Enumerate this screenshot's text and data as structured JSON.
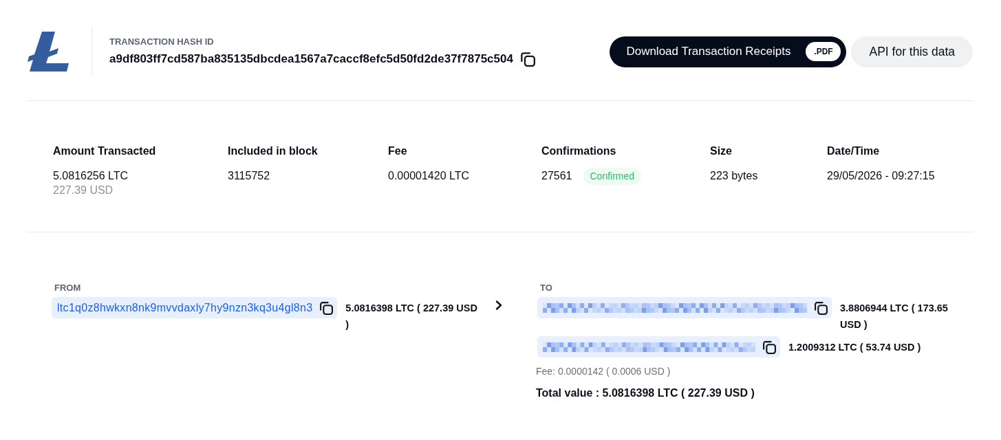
{
  "header": {
    "hash_label": "TRANSACTION HASH ID",
    "hash": "a9df803ff7cd587ba835135dbcdea1567a7caccf8efc5d50fd2de37f7875c504",
    "buttons": [
      {
        "kind": "download",
        "label": "Download Transaction Receipts",
        "tag": ".PDF"
      },
      {
        "kind": "api",
        "label": "API for this data"
      }
    ]
  },
  "stats": [
    {
      "label": "Amount Transacted",
      "value": "5.0816256 LTC",
      "secondary": "227.39 USD"
    },
    {
      "label": "Included in block",
      "value": "3115752"
    },
    {
      "label": "Fee",
      "value": "0.00001420 LTC"
    },
    {
      "label": "Confirmations",
      "value": "27561",
      "badge": "Confirmed"
    },
    {
      "label": "Size",
      "value": "223 bytes"
    },
    {
      "label": "Date/Time",
      "value": "29/05/2026 - 09:27:15"
    }
  ],
  "transfer": {
    "from": {
      "label": "FROM",
      "entries": [
        {
          "kind": "address",
          "address": "ltc1q0z8hwkxn8nk9mvvdaxly7hy9nzn3kq3u4gl8n3",
          "amount": "5.0816398 LTC ( 227.39 USD )"
        }
      ]
    },
    "to": {
      "label": "TO",
      "entries": [
        {
          "kind": "redacted",
          "amount": "3.8806944 LTC ( 173.65 USD )"
        },
        {
          "kind": "redacted",
          "amount": "1.2009312 LTC ( 53.74 USD )"
        }
      ],
      "fee": "Fee: 0.0000142 ( 0.0006 USD )",
      "total": "Total value : 5.0816398 LTC ( 227.39 USD )"
    }
  }
}
